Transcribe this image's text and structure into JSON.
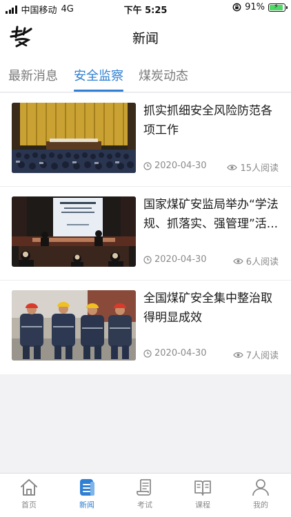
{
  "status_bar": {
    "carrier": "中国移动",
    "network": "4G",
    "time": "下午 5:25",
    "battery": "91%",
    "battery_level": 0.91,
    "battery_color": "#4cd964"
  },
  "header": {
    "logo_icon": "app-logo-icon",
    "title": "新闻"
  },
  "tabs": [
    {
      "label": "最新消息",
      "active": false
    },
    {
      "label": "安全监察",
      "active": true
    },
    {
      "label": "煤炭动态",
      "active": false
    }
  ],
  "accent_color": "#2f7fd3",
  "news": [
    {
      "title": "抓实抓细安全风险防范各项工作",
      "date": "2020-04-30",
      "reads": "15人阅读",
      "image": "conference-hall-photo"
    },
    {
      "title": "国家煤矿安监局举办“学法规、抓落实、强管理”活...",
      "date": "2020-04-30",
      "reads": "6人阅读",
      "image": "training-session-photo"
    },
    {
      "title": "全国煤矿安全集中整治取得明显成效",
      "date": "2020-04-30",
      "reads": "7人阅读",
      "image": "miners-photo"
    }
  ],
  "bottom_nav": [
    {
      "label": "首页",
      "icon": "home-icon",
      "active": false
    },
    {
      "label": "新闻",
      "icon": "news-icon",
      "active": true
    },
    {
      "label": "考试",
      "icon": "exam-scroll-icon",
      "active": false
    },
    {
      "label": "课程",
      "icon": "book-icon",
      "active": false
    },
    {
      "label": "我的",
      "icon": "person-icon",
      "active": false
    }
  ]
}
